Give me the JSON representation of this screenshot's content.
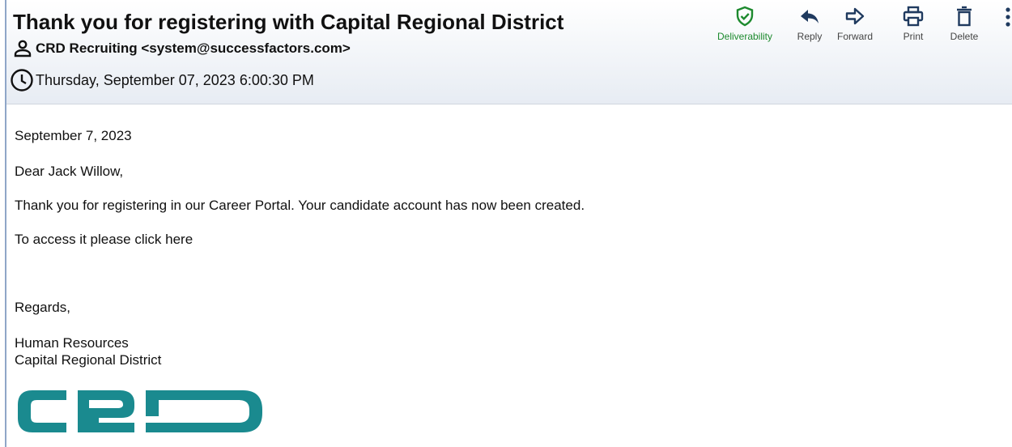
{
  "email": {
    "subject": "Thank you for registering with Capital Regional District",
    "sender": "CRD Recruiting <system@successfactors.com>",
    "date": "Thursday, September 07, 2023 6:00:30 PM"
  },
  "toolbar": {
    "deliverability": "Deliverability",
    "reply": "Reply",
    "forward": "Forward",
    "print": "Print",
    "delete": "Delete"
  },
  "message": {
    "date_line": "September 7, 2023",
    "greeting": "Dear Jack Willow,",
    "line1": "Thank you for registering in our Career Portal. Your candidate account has now been created.",
    "line2": "To access it please click here",
    "closing": "Regards,",
    "sig_line1": "Human Resources",
    "sig_line2": "Capital Regional District"
  },
  "logo": {
    "text": "CRD",
    "color": "#1a8a8f"
  },
  "colors": {
    "accent_green": "#1d8a2e",
    "header_bg_bottom": "#e7ecf3"
  },
  "icons": [
    "person-icon",
    "clock-icon",
    "shield-check-icon",
    "reply-icon",
    "forward-icon",
    "print-icon",
    "delete-icon",
    "more-vertical-icon"
  ]
}
